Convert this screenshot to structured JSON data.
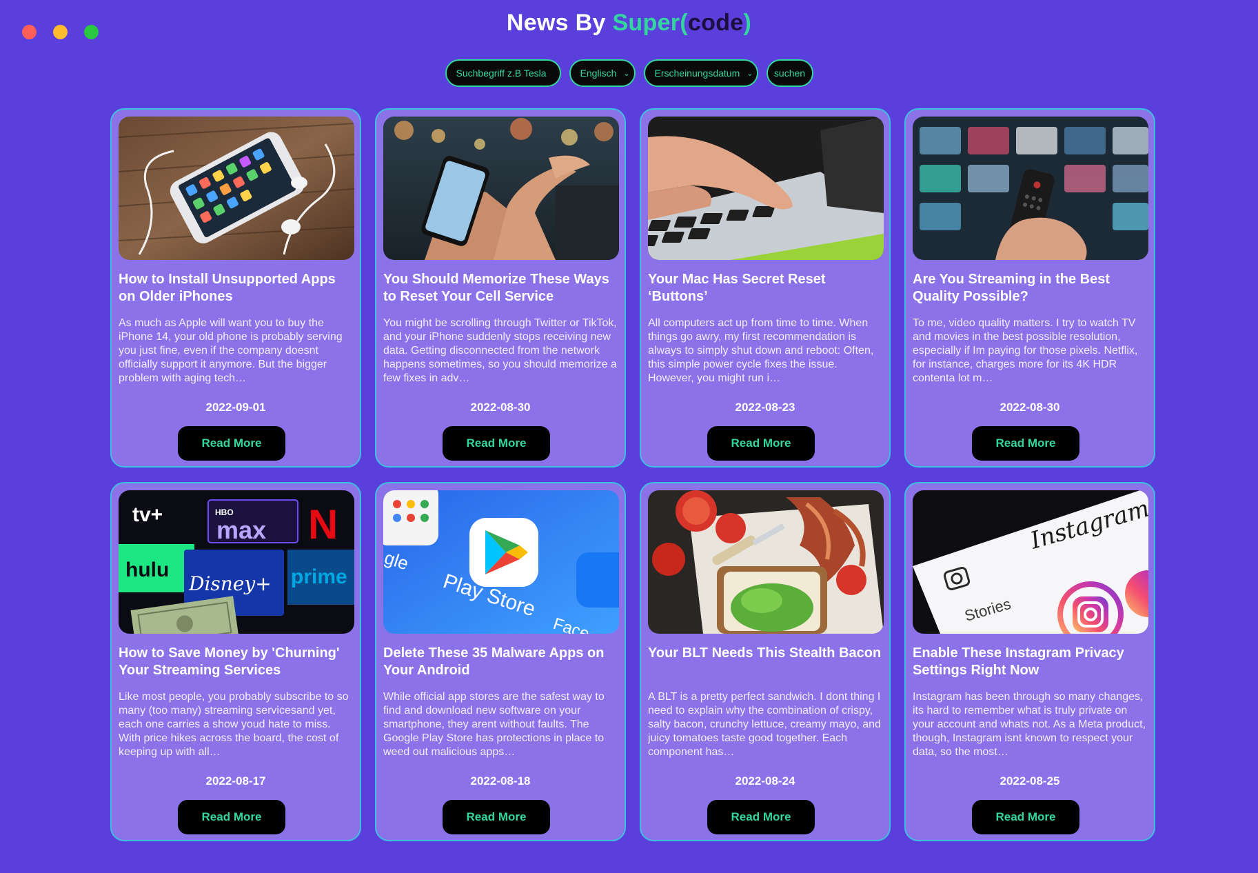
{
  "window": {
    "controls": [
      "close",
      "minimize",
      "maximize"
    ]
  },
  "header": {
    "title_prefix": "News By ",
    "brand_super": "Super",
    "brand_open": "(",
    "brand_code": "code",
    "brand_close": ")"
  },
  "search": {
    "query_placeholder": "Suchbegriff z.B Tesla",
    "language_value": "Englisch",
    "sort_value": "Erscheinungsdatum",
    "submit_label": "suchen"
  },
  "colors": {
    "background": "#5b3fdc",
    "card": "#8b72e8",
    "accent": "#34d6a0",
    "card_border": "#3fbfe0"
  },
  "articles": [
    {
      "image": "iphone-with-earbuds",
      "title": "How to Install Unsupported Apps on Older iPhones",
      "description": "As much as Apple will want you to buy the iPhone 14, your old phone is probably serving you just fine, even if the company doesnt officially support it anymore. But the bigger problem with aging tech…",
      "date": "2022-09-01",
      "button": "Read More"
    },
    {
      "image": "hand-scrolling-phone",
      "title": "You Should Memorize These Ways to Reset Your Cell Service",
      "description": "You might be scrolling through Twitter or TikTok, and your iPhone suddenly stops receiving new data. Getting disconnected from the network happens sometimes, so you should memorize a few fixes in adv…",
      "date": "2022-08-30",
      "button": "Read More"
    },
    {
      "image": "finger-on-mac-keyboard",
      "title": "Your Mac Has Secret Reset ‘Buttons’",
      "description": "All computers act up from time to time. When things go awry, my first recommendation is always to simply shut down and reboot: Often, this simple power cycle fixes the issue. However, you might run i…",
      "date": "2022-08-23",
      "button": "Read More"
    },
    {
      "image": "tv-remote",
      "title": "Are You Streaming in the Best Quality Possible?",
      "description": "To me, video quality matters. I try to watch TV and movies in the best possible resolution, especially if Im paying for those pixels. Netflix, for instance, charges more for its 4K HDR contenta lot m…",
      "date": "2022-08-30",
      "button": "Read More"
    },
    {
      "image": "streaming-logos-money",
      "title": "How to Save Money by 'Churning' Your Streaming Services",
      "description": "Like most people, you probably subscribe to so many (too many) streaming servicesand yet, each one carries a show youd hate to miss. With price hikes across the board, the cost of keeping up with all…",
      "date": "2022-08-17",
      "button": "Read More",
      "logos": {
        "tv": "tv+",
        "hbo": "HBO",
        "max": "max",
        "netflix": "N",
        "hulu": "hulu",
        "disney": "Disney+",
        "prime": "prime"
      }
    },
    {
      "image": "play-store-icon",
      "title": "Delete These 35 Malware Apps on Your Android",
      "description": "While official app stores are the safest way to find and download new software on your smartphone, they arent without faults. The Google Play Store has protections in place to weed out malicious apps…",
      "date": "2022-08-18",
      "button": "Read More",
      "logos": {
        "play": "Play Store",
        "gle": "gle",
        "face": "Face"
      }
    },
    {
      "image": "blt-sandwich",
      "title": "Your BLT Needs This Stealth Bacon",
      "description": "A BLT is a pretty perfect sandwich. I dont thing I need to explain why the combination of crispy, salty bacon, crunchy lettuce, creamy mayo, and juicy tomatoes taste good together. Each component has…",
      "date": "2022-08-24",
      "button": "Read More"
    },
    {
      "image": "instagram-app",
      "title": "Enable These Instagram Privacy Settings Right Now",
      "description": "Instagram has been through so many changes, its hard to remember what is truly private on your account and whats not. As a Meta product, though, Instagram isnt known to respect your data, so the most…",
      "date": "2022-08-25",
      "button": "Read More",
      "logos": {
        "brand": "Instagram",
        "stories": "Stories"
      }
    }
  ]
}
